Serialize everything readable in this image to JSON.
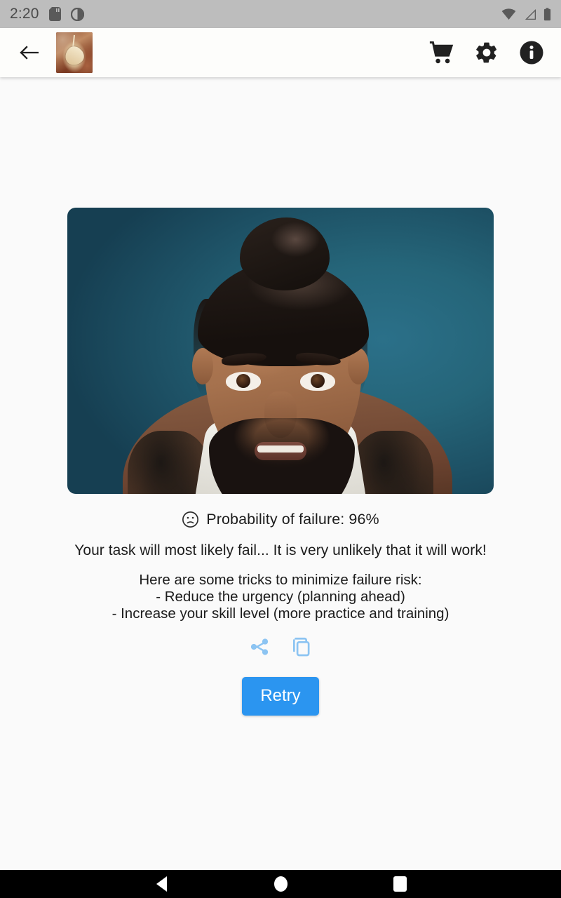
{
  "status_bar": {
    "clock": "2:20",
    "left_icons": [
      "sd-card-icon",
      "half-circle-icon"
    ],
    "right_icons": [
      "wifi-icon",
      "cellular-signal-icon",
      "battery-icon"
    ],
    "background_color": "#bdbdbd"
  },
  "app_bar": {
    "back_icon": "back-arrow-icon",
    "logo_icon": "app-logo-pendulum-icon",
    "actions": [
      {
        "name": "cart-icon",
        "label": "Cart"
      },
      {
        "name": "settings-gear-icon",
        "label": "Settings"
      },
      {
        "name": "info-icon",
        "label": "Info"
      }
    ],
    "background_color": "#fdfdfb"
  },
  "main": {
    "photo": {
      "name": "result-photo",
      "alt": "Portrait of a bearded man with a top-knot hairstyle and tattoos against a teal background",
      "background_color": "#226278"
    },
    "probability": {
      "icon": "frowning-face-icon",
      "text": "Probability of failure: 96%",
      "value": 96,
      "unit": "%"
    },
    "message": "Your task will most likely fail... It is very unlikely that it will work!",
    "tips": {
      "heading": "Here are some tricks to minimize failure risk:",
      "items": [
        "- Reduce the urgency (planning ahead)",
        "- Increase your skill level (more practice and training)"
      ]
    },
    "actions": [
      {
        "name": "share-icon",
        "label": "Share",
        "color": "#8cc4f2"
      },
      {
        "name": "copy-icon",
        "label": "Copy",
        "color": "#8cc4f2"
      }
    ],
    "retry_button": {
      "label": "Retry",
      "background_color": "#2b95f0",
      "text_color": "#ffffff"
    },
    "background_color": "#fafafa"
  },
  "nav_bar": {
    "background_color": "#000000",
    "buttons": [
      {
        "name": "nav-back-button",
        "label": "Back"
      },
      {
        "name": "nav-home-button",
        "label": "Home"
      },
      {
        "name": "nav-recents-button",
        "label": "Recents"
      }
    ]
  }
}
